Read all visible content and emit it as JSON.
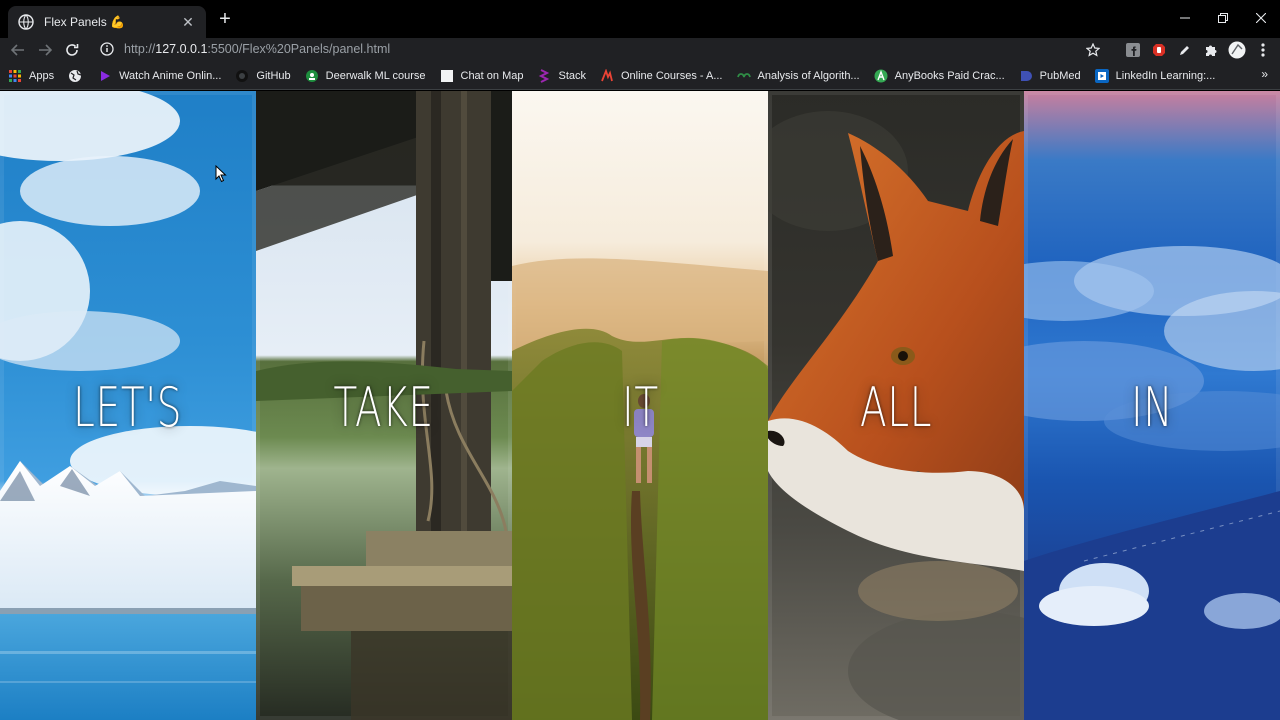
{
  "window": {
    "tab_title": "Flex Panels 💪",
    "new_tab_label": "+",
    "close_label": "✕"
  },
  "address_bar": {
    "url_scheme": "http://",
    "url_host": "127.0.0.1",
    "url_rest": ":5500/Flex%20Panels/panel.html"
  },
  "bookmarks": [
    {
      "label": "Apps",
      "icon": "apps-grid-icon",
      "color": "#4285f4"
    },
    {
      "label": "",
      "icon": "globe-icon",
      "color": "#e8eaed"
    },
    {
      "label": "Watch Anime Onlin...",
      "icon": "anime-icon",
      "color": "#8a2be2"
    },
    {
      "label": "GitHub",
      "icon": "github-icon",
      "color": "#202124"
    },
    {
      "label": "Deerwalk ML course",
      "icon": "classroom-icon",
      "color": "#1e8e3e"
    },
    {
      "label": "Chat on Map",
      "icon": "page-icon",
      "color": "#f1f3f4"
    },
    {
      "label": "Stack",
      "icon": "stack-icon",
      "color": "#7b1fa2"
    },
    {
      "label": "Online Courses - A...",
      "icon": "udemy-icon",
      "color": "#ea4335"
    },
    {
      "label": "Analysis of Algorith...",
      "icon": "gfg-icon",
      "color": "#2f8d46"
    },
    {
      "label": "AnyBooks Paid Crac...",
      "icon": "anybooks-icon",
      "color": "#34a853"
    },
    {
      "label": "PubMed",
      "icon": "pubmed-icon",
      "color": "#3f51b5"
    },
    {
      "label": "LinkedIn Learning:...",
      "icon": "linkedin-icon",
      "color": "#0a66c2"
    }
  ],
  "bookmarks_more": "»",
  "panels": [
    {
      "word": "LET'S",
      "scene": "sky-mountains"
    },
    {
      "word": "TAKE",
      "scene": "dock-lake"
    },
    {
      "word": "IT",
      "scene": "hiker-ridge"
    },
    {
      "word": "ALL",
      "scene": "fox"
    },
    {
      "word": "IN",
      "scene": "clouds-hills"
    }
  ]
}
